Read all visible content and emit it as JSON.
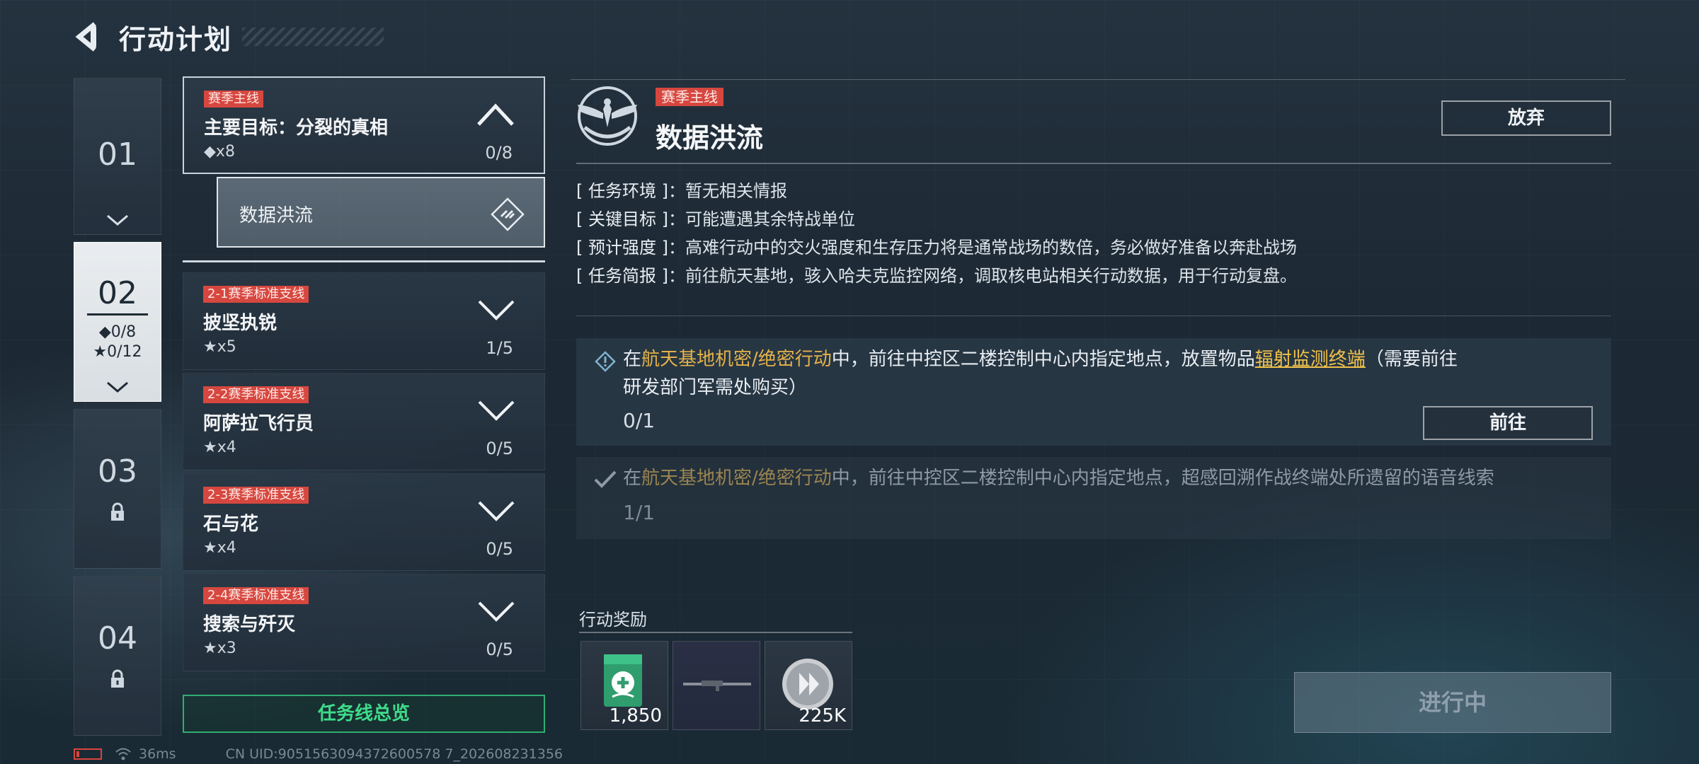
{
  "header": {
    "title": "行动计划"
  },
  "chapters": [
    {
      "num": "01"
    },
    {
      "num": "02",
      "diamond_progress": "◆0/8",
      "star_progress": "★0/12"
    },
    {
      "num": "03"
    },
    {
      "num": "04"
    }
  ],
  "missions": {
    "main": {
      "tag": "赛季主线",
      "title": "主要目标：分裂的真相",
      "reward": "◆x8",
      "count": "0/8"
    },
    "sub_selected": {
      "title": "数据洪流"
    },
    "side": [
      {
        "tag": "2-1赛季标准支线",
        "title": "披坚执锐",
        "reward": "★x5",
        "count": "1/5"
      },
      {
        "tag": "2-2赛季标准支线",
        "title": "阿萨拉飞行员",
        "reward": "★x4",
        "count": "0/5"
      },
      {
        "tag": "2-3赛季标准支线",
        "title": "石与花",
        "reward": "★x4",
        "count": "0/5"
      },
      {
        "tag": "2-4赛季标准支线",
        "title": "搜索与歼灭",
        "reward": "★x3",
        "count": "0/5"
      }
    ],
    "overview_label": "任务线总览"
  },
  "detail": {
    "tag": "赛季主线",
    "title": "数据洪流",
    "abandon_label": "放弃",
    "info": [
      {
        "label": "[ 任务环境 ]",
        "value": "暂无相关情报"
      },
      {
        "label": "[ 关键目标 ]",
        "value": "可能遭遇其余特战单位"
      },
      {
        "label": "[ 预计强度 ]",
        "value": "高难行动中的交火强度和生存压力将是通常战场的数倍，务必做好准备以奔赴战场"
      },
      {
        "label": "[ 任务简报 ]",
        "value": "前往航天基地，骇入哈夫克监控网络，调取核电站相关行动数据，用于行动复盘。"
      }
    ],
    "tasks": [
      {
        "prefix": "在",
        "highlight": "航天基地机密/绝密行动",
        "middle": "中，前往中控区二楼控制中心内指定地点，放置物品",
        "link": "辐射监测终端",
        "suffix": "（需要前往研发部门军需处购买）",
        "progress": "0/1",
        "go_label": "前往"
      },
      {
        "prefix": "在",
        "highlight": "航天基地机密/绝密行动",
        "middle": "中，前往中控区二楼控制中心内指定地点，超感回溯作战终端处所遗留的语音线索",
        "progress": "1/1"
      }
    ],
    "rewards_title": "行动奖励",
    "rewards": [
      {
        "icon": "medic-crate-icon",
        "qty": "1,850"
      },
      {
        "icon": "rifle-icon",
        "qty": ""
      },
      {
        "icon": "silver-coin-icon",
        "qty": "225K"
      }
    ],
    "status_button": "进行中"
  },
  "status_bar": {
    "ping": "36ms",
    "uid": "CN UID:9051563094372600578 7_202608231356"
  },
  "colors": {
    "tag_red": "#d6473f",
    "accent_green": "#3fdc8a",
    "highlight_gold": "#e4b24a"
  }
}
